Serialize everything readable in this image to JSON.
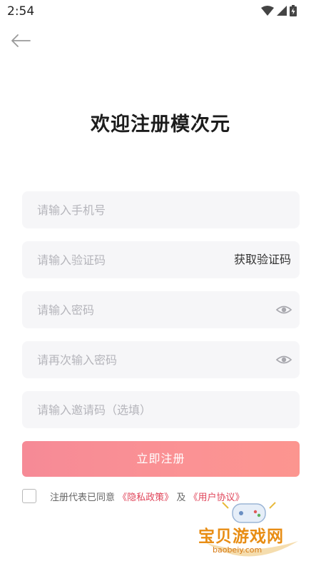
{
  "status_bar": {
    "time": "2:54"
  },
  "header": {
    "back_icon": "arrow-left-icon",
    "title": "欢迎注册模次元"
  },
  "form": {
    "phone_placeholder": "请输入手机号",
    "code_placeholder": "请输入验证码",
    "get_code_label": "获取验证码",
    "password_placeholder": "请输入密码",
    "confirm_placeholder": "请再次输入密码",
    "invite_placeholder": "请输入邀请码（选填）",
    "submit_label": "立即注册"
  },
  "agreement": {
    "prefix": "注册代表已同意",
    "privacy_link": "《隐私政策》",
    "and": "及",
    "terms_link": "《用户协议》",
    "checked": false
  },
  "watermark": {
    "title": "宝贝游戏网",
    "url": "baobeiy.com"
  },
  "colors": {
    "accent": "#fb9294",
    "link": "#e0455a",
    "field_bg": "#f6f6f8"
  }
}
